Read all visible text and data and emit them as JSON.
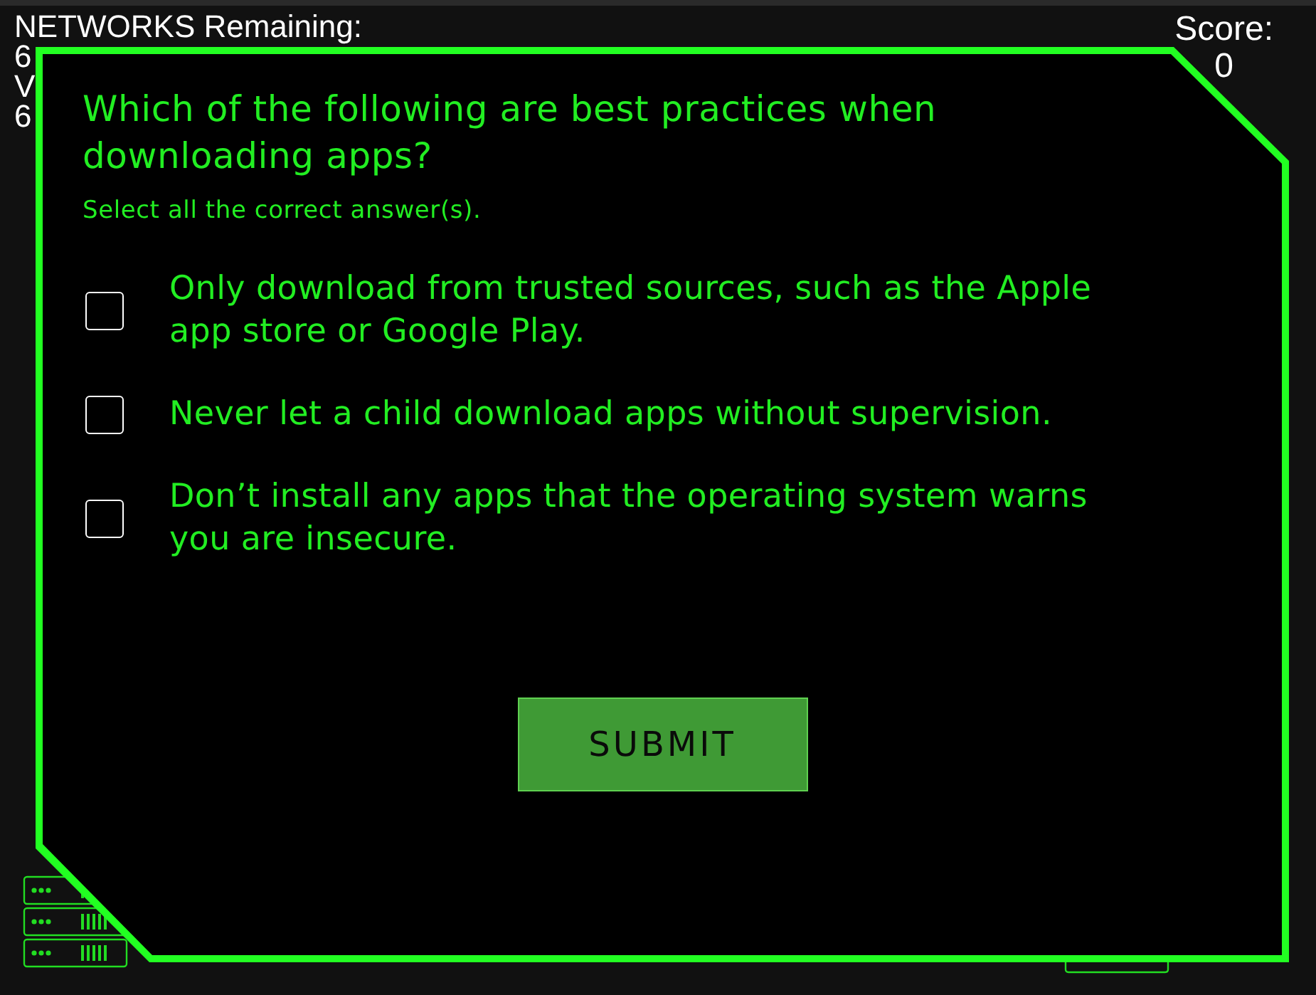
{
  "hud": {
    "networks_label": "NETWORKS Remaining:",
    "lines": [
      "6",
      "V",
      "6"
    ]
  },
  "score": {
    "label": "Score:",
    "value": "0"
  },
  "question": "Which of the following are best practices when downloading apps?",
  "instruction": "Select all the correct answer(s).",
  "options": [
    {
      "text": "Only download from trusted sources, such as the Apple app store or Google Play.",
      "checked": false
    },
    {
      "text": "Never let a child download apps without supervision.",
      "checked": false
    },
    {
      "text": "Don’t install any apps that the operating system warns you are insecure.",
      "checked": false
    }
  ],
  "submit": "SUBMIT"
}
